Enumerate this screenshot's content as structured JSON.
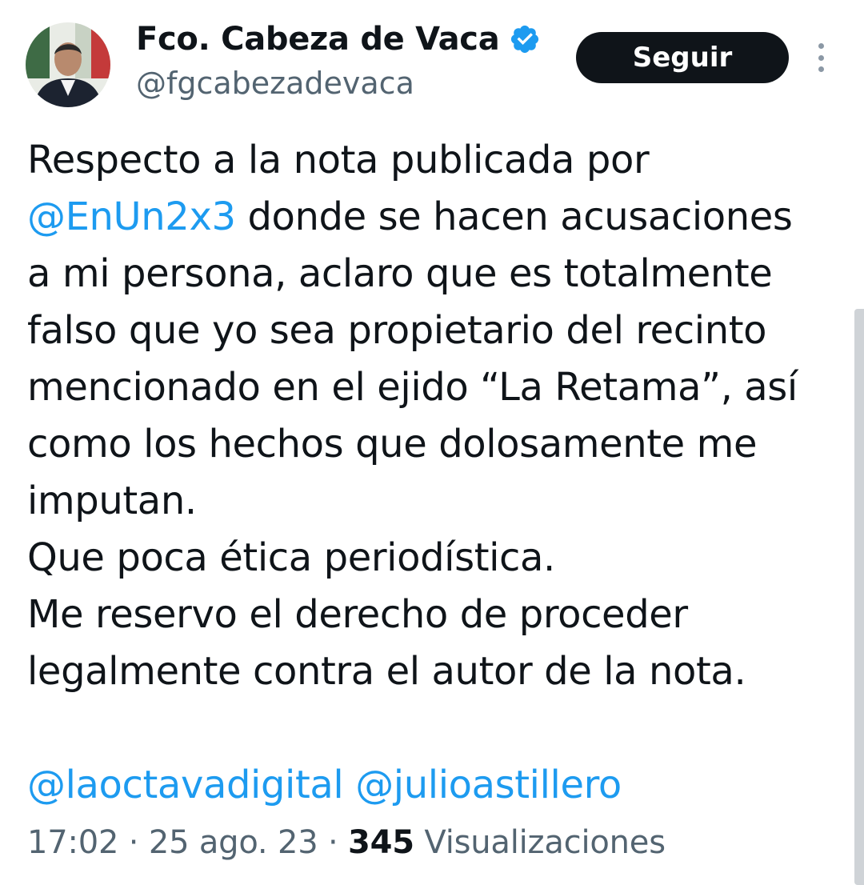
{
  "author": {
    "display_name": "Fco. Cabeza de Vaca",
    "handle": "@fgcabezadevaca",
    "verified_icon": "verified-badge-icon",
    "badge_color": "#1d9bf0"
  },
  "actions": {
    "follow_label": "Seguir",
    "more_icon": "more-vertical-icon"
  },
  "tweet": {
    "line1": "Respecto a la nota publicada por",
    "mention1": "@EnUn2x3",
    "line2_rest": " donde se hacen acusaciones",
    "line3": "a mi persona, aclaro que es totalmente",
    "line4": "falso que yo sea propietario del recinto",
    "line5": "mencionado en el ejido “La Retama”, así",
    "line6": "como los hechos que dolosamente me",
    "line7": "imputan.",
    "line8": "Que poca ética periodística.",
    "line9": "Me reservo el derecho de proceder",
    "line10": "legalmente contra el autor de la nota.",
    "mention2": "@laoctavadigital",
    "mention3": "@julioastillero"
  },
  "meta": {
    "time": "17:02",
    "date": "25 ago. 23",
    "separator": " · ",
    "views_count": "345",
    "views_label": "Visualizaciones"
  },
  "colors": {
    "text": "#0f1419",
    "secondary": "#536471",
    "link": "#1d9bf0",
    "button_bg": "#0f1419"
  }
}
